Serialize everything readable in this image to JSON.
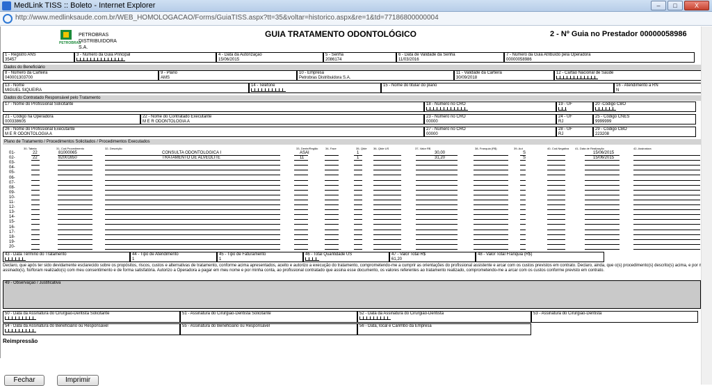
{
  "window": {
    "title": "MedLink TISS :: Boleto - Internet Explorer",
    "url": "http://www.medlinksaude.com.br/WEB_HOMOLOGACAO/Forms/GuiaTISS.aspx?tt=35&voltar=historico.aspx&re=1&td=77186800000004",
    "min": "–",
    "max": "□",
    "close": "X"
  },
  "logo": {
    "brand": "PETROBRAS",
    "line1": "PETROBRAS",
    "line2": "DISTRIBUIDORA S.A."
  },
  "guide": {
    "title": "GUIA TRATAMENTO ODONTOLÓGICO",
    "number": "2 - Nº Guia no Prestador 00000058986"
  },
  "fields": {
    "f1": {
      "label": "1 - Registro ANS",
      "value": "35457"
    },
    "f3": {
      "label": "3 - Número da Guia Principal",
      "value": ""
    },
    "f4": {
      "label": "4 - Data da Autorização",
      "value": "15/06/2015"
    },
    "f5": {
      "label": "5 - Senha",
      "value": "2086174"
    },
    "f6": {
      "label": "6 - Data de Validade da Senha",
      "value": "11/03/2016"
    },
    "f7": {
      "label": "7 - Número da Guia Atribuído pela Operadora",
      "value": "00000058986"
    },
    "f8": {
      "label": "8 - Número da Carteira",
      "value": "040001303700"
    },
    "f9": {
      "label": "9 - Plano",
      "value": "AMS"
    },
    "f10": {
      "label": "10 - Empresa",
      "value": "Petrobras Distribuidora S.A."
    },
    "f11": {
      "label": "11 - Validade da Carteira",
      "value": "30/09/2018"
    },
    "f12": {
      "label": "12 - Cartão Nacional de Saúde",
      "value": ""
    },
    "f13": {
      "label": "13 - Nome",
      "value": "MIGUEL SIQUEIRA"
    },
    "f14": {
      "label": "14 - Telefone",
      "value": ""
    },
    "f15": {
      "label": "15 - Nome do titular do plano",
      "value": ""
    },
    "f16": {
      "label": "16 - Atendimento a RN",
      "value": "N"
    },
    "f17": {
      "label": "17 - Nome do Profissional Solicitante",
      "value": ""
    },
    "f18": {
      "label": "18 - Número no CRO",
      "value": ""
    },
    "f19": {
      "label": "19 - UF",
      "value": ""
    },
    "f20": {
      "label": "20 -Código CBO",
      "value": ""
    },
    "f21": {
      "label": "21 - Código na Operadora",
      "value": "000338605"
    },
    "f22": {
      "label": "22 - Nome do Contratado Executante",
      "value": "M E R ODONTOLOGIA A"
    },
    "f23": {
      "label": "23 - Número no CRO",
      "value": "00000"
    },
    "f24": {
      "label": "24 - UF",
      "value": "RJ"
    },
    "f25": {
      "label": "25 - Código CNES",
      "value": "9999999"
    },
    "f26": {
      "label": "26 - Nome do Profissional Executante",
      "value": "M E R ODONTOLOGIA A"
    },
    "f27": {
      "label": "27 - Número no CRO",
      "value": "00000"
    },
    "f28": {
      "label": "28 - UF",
      "value": "RJ"
    },
    "f29": {
      "label": "29 - Código CBO",
      "value": "223208"
    },
    "f43": {
      "label": "43 - Data Término do Tratamento",
      "value": ""
    },
    "f44": {
      "label": "44 - Tipo de Atendimento",
      "value": "1"
    },
    "f45": {
      "label": "45 - Tipo de Faturamento",
      "value": "1"
    },
    "f46": {
      "label": "46 - Total Quantidade US",
      "value": ""
    },
    "f47": {
      "label": "47 - Valor Total R$",
      "value": "61,20"
    },
    "f48": {
      "label": "48 - Valor Total Franquia (R$)",
      "value": ""
    },
    "f49": {
      "label": "49 - Observação / Justificativa",
      "value": ""
    },
    "f50": {
      "label": "50 - Data da Assinatura do Cirurgião-Dentista Solicitante"
    },
    "f51": {
      "label": "51 - Assinatura do Cirurgião-Dentista Solicitante"
    },
    "f52": {
      "label": "52 - Data da Assinatura do Cirurgião-Dentista"
    },
    "f53": {
      "label": "53 - Assinatura do Cirurgião-Dentista"
    },
    "f54": {
      "label": "54 - Data da Assinatura do Beneficiário ou Responsável"
    },
    "f55": {
      "label": "55 - Assinatura do Beneficiário ou Responsável"
    },
    "f56": {
      "label": "56 - Data, local e Carimbo da Empresa"
    }
  },
  "sections": {
    "beneficiario": "Dados do Beneficiário",
    "contratado": "Dados do Contratado Responsável pelo Tratamento",
    "plano": "Plano de Tratamento / Procedimentos Solicitados / Procedimentos Executados"
  },
  "table": {
    "headers": [
      "30- Tabela",
      "31- Cod.Procedimento",
      "32- Descrição",
      "33- Dente/Região",
      "34- Face",
      "35- Qtde",
      "36- Qtde US",
      "37- Valor R$",
      "38- Franquia (R$)",
      "39- Aut",
      "40- Cod.Negativa",
      "41- Data de Realização",
      "42- Assinatura"
    ],
    "rows": [
      {
        "n": "01-",
        "tabela": "22",
        "codigo": "81000065",
        "descricao": "CONSULTA ODONTOLOGICA I",
        "dente": "ASAI",
        "qtde": "1",
        "valor": "30,00",
        "aut": "S",
        "data": "15/06/2015"
      },
      {
        "n": "02-",
        "tabela": "22",
        "codigo": "82001650",
        "descricao": "TRATAMENTO DE ALVEOLITE",
        "dente": "11",
        "qtde": "1",
        "valor": "31,20",
        "aut": "S",
        "data": "15/06/2015"
      }
    ],
    "empty_rows": [
      "03-",
      "04-",
      "05-",
      "06-",
      "07-",
      "08-",
      "09-",
      "10-",
      "11-",
      "12-",
      "13-",
      "14-",
      "15-",
      "16-",
      "17-",
      "18-",
      "19-",
      "20-"
    ]
  },
  "declaration": "Declaro, que após ter sido devidamente esclarecido sobre os propósitos, riscos, custos e alternativas de tratamento, conforme acima apresentados, aceito e autorizo a execução do tratamento, comprometendo-me a cumprir as orientações do profissional assistente e arcar com os custos previstos em contrato. Declaro, ainda, que o(s) procedimento(s) descrito(s) acima, e por mim assinado(s), foi/foram realizado(s) com meu consentimento e de forma satisfatória. Autorizo a Operadora a pagar em meu nome e por minha conta, ao profissional contratado que assina esse documento, os valores referentes ao tratamento realizado, comprometendo-me a arcar com os custos conforme previsto em contrato.",
  "reprint": "Reimpressão",
  "buttons": {
    "close": "Fechar",
    "print": "Imprimir"
  }
}
